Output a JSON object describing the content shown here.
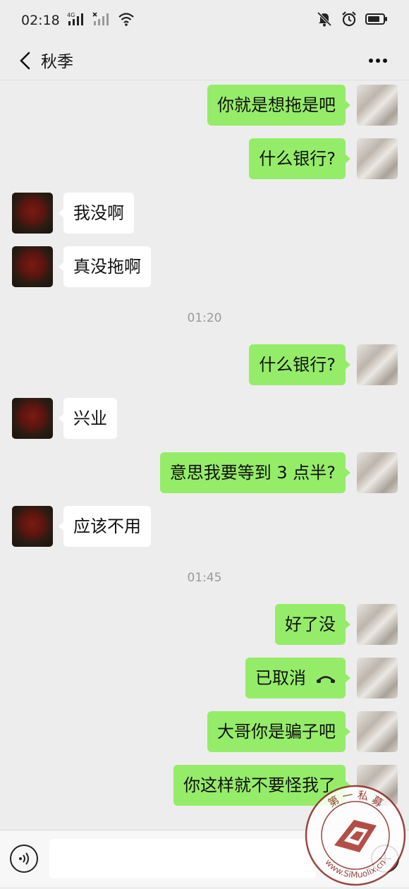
{
  "status_bar": {
    "time": "02:18",
    "network": "4G",
    "icons": [
      "signal-icon",
      "no-signal-icon",
      "wifi-icon",
      "mute-icon",
      "alarm-icon",
      "battery-icon"
    ]
  },
  "header": {
    "title": "秋季",
    "back_icon": "chevron-left-icon",
    "more_icon": "more-icon"
  },
  "messages": [
    {
      "dir": "out",
      "text": "你就是想拖是吧"
    },
    {
      "dir": "out",
      "text": "什么银行?"
    },
    {
      "dir": "in",
      "text": "我没啊"
    },
    {
      "dir": "in",
      "text": "真没拖啊"
    },
    {
      "time": "01:20"
    },
    {
      "dir": "out",
      "text": "什么银行?"
    },
    {
      "dir": "in",
      "text": "兴业"
    },
    {
      "dir": "out",
      "text": "意思我要等到 3 点半?"
    },
    {
      "dir": "in",
      "text": "应该不用"
    },
    {
      "time": "01:45"
    },
    {
      "dir": "out",
      "text": "好了没"
    },
    {
      "dir": "out",
      "text": "已取消",
      "icon": "hangup-icon"
    },
    {
      "dir": "out",
      "text": "大哥你是骗子吧"
    },
    {
      "dir": "out",
      "text": "你这样就不要怪我了"
    }
  ],
  "input_bar": {
    "voice_icon": "voice-icon",
    "plus_icon": "plus-icon"
  },
  "watermark": {
    "top_text": "第 一 私 募",
    "bottom_text": "www.SiMuolix.cn"
  },
  "colors": {
    "outgoing_bubble": "#95ec69",
    "incoming_bubble": "#ffffff",
    "background": "#ededed"
  }
}
